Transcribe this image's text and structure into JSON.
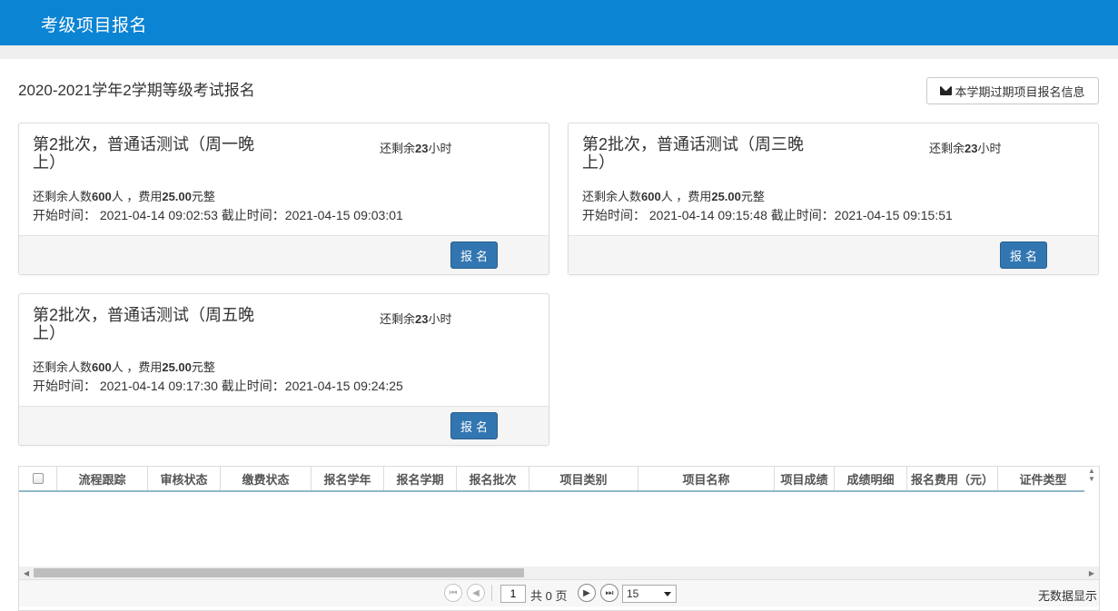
{
  "header": {
    "title": "考级项目报名"
  },
  "page": {
    "heading": "2020-2021学年2学期等级考试报名",
    "expired_button_label": "本学期过期项目报名信息"
  },
  "labels": {
    "remaining_time_prefix": "还剩余",
    "remaining_time_suffix": "小时",
    "remaining_people_prefix": "还剩余人数",
    "remaining_people_suffix": "人 ，费用",
    "fee_suffix": "元整",
    "start_time_label": "开始时间：",
    "end_time_label": "截止时间：",
    "signup_label": "报名"
  },
  "cards": [
    {
      "title": "第2批次，普通话测试（周一晚上）",
      "remaining_hours": "23",
      "remaining_people": "600",
      "fee": "25.00",
      "start_time": "2021-04-14 09:02:53",
      "end_time": "2021-04-15 09:03:01"
    },
    {
      "title": "第2批次，普通话测试（周三晚上）",
      "remaining_hours": "23",
      "remaining_people": "600",
      "fee": "25.00",
      "start_time": "2021-04-14 09:15:48",
      "end_time": "2021-04-15 09:15:51"
    },
    {
      "title": "第2批次，普通话测试（周五晚上）",
      "remaining_hours": "23",
      "remaining_people": "600",
      "fee": "25.00",
      "start_time": "2021-04-14 09:17:30",
      "end_time": "2021-04-15 09:24:25"
    }
  ],
  "grid": {
    "columns": [
      "流程跟踪",
      "审核状态",
      "缴费状态",
      "报名学年",
      "报名学期",
      "报名批次",
      "项目类别",
      "项目名称",
      "项目成绩",
      "成绩明细",
      "报名费用（元）",
      "证件类型"
    ],
    "rows": []
  },
  "pager": {
    "current_page": "1",
    "total_text": "共 0 页",
    "page_size": "15",
    "no_data_text": "无数据显示"
  },
  "colors": {
    "header_bg": "#0b84d4",
    "primary_button": "#3276b1"
  }
}
